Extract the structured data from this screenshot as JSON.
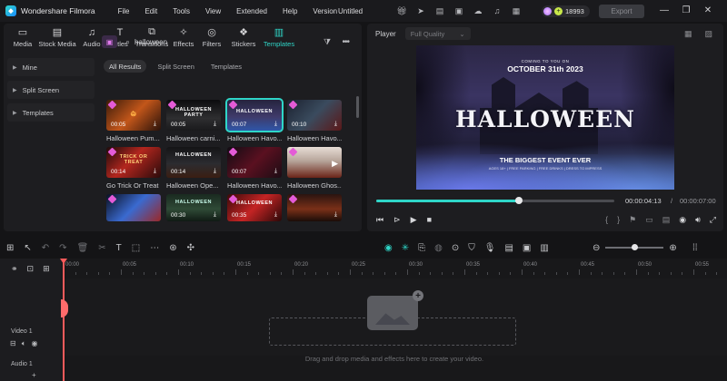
{
  "app": {
    "name": "Wondershare Filmora",
    "doc_title": "Untitled",
    "menu": [
      "File",
      "Edit",
      "Tools",
      "View",
      "Extended",
      "Help",
      "Version"
    ],
    "credits": "18993",
    "export_label": "Export"
  },
  "tabs": [
    {
      "label": "Media",
      "icon": "media-icon"
    },
    {
      "label": "Stock Media",
      "icon": "stock-media-icon"
    },
    {
      "label": "Audio",
      "icon": "audio-icon"
    },
    {
      "label": "Titles",
      "icon": "titles-icon"
    },
    {
      "label": "Transitions",
      "icon": "transitions-icon"
    },
    {
      "label": "Effects",
      "icon": "effects-icon"
    },
    {
      "label": "Filters",
      "icon": "filters-icon"
    },
    {
      "label": "Stickers",
      "icon": "stickers-icon"
    },
    {
      "label": "Templates",
      "icon": "templates-icon",
      "active": true
    }
  ],
  "sidebar": {
    "items": [
      {
        "label": "Mine"
      },
      {
        "label": "Split Screen"
      },
      {
        "label": "Templates"
      }
    ]
  },
  "search": {
    "value": "halloween",
    "placeholder": "Search"
  },
  "filters": [
    {
      "label": "All Results",
      "active": true
    },
    {
      "label": "Split Screen",
      "active": false
    },
    {
      "label": "Templates",
      "active": false
    }
  ],
  "results": [
    {
      "name": "Halloween Pum...",
      "duration": "00:05",
      "premium": true
    },
    {
      "name": "Halloween carni...",
      "duration": "00:05",
      "premium": true
    },
    {
      "name": "Halloween Havo...",
      "duration": "00:07",
      "premium": true,
      "selected": true
    },
    {
      "name": "Halloween Havo...",
      "duration": "00:10",
      "premium": true
    },
    {
      "name": "Go Trick Or Treat",
      "duration": "00:14",
      "premium": true
    },
    {
      "name": "Halloween Ope...",
      "duration": "00:14",
      "premium": false
    },
    {
      "name": "Halloween Havo...",
      "duration": "00:07",
      "premium": true
    },
    {
      "name": "Halloween Ghos...",
      "duration": "",
      "premium": true
    },
    {
      "name": "",
      "duration": "",
      "premium": true
    },
    {
      "name": "",
      "duration": "00:30",
      "premium": false
    },
    {
      "name": "",
      "duration": "00:35",
      "premium": true
    },
    {
      "name": "",
      "duration": "",
      "premium": true
    }
  ],
  "player": {
    "label": "Player",
    "quality": "Full Quality",
    "current_time": "00:00:04:13",
    "total_time": "00:00:07:00",
    "progress": 0.6,
    "video_text": {
      "coming": "COMING TO YOU ON",
      "date": "OCTOBER 31th 2023",
      "title": "HALLOWEEN",
      "event": "THE BIGGEST EVENT EVER",
      "details": "AGES 18+  |  FREE PARKING  |  FREE DRINKS  |  DRESS TO IMPRESS"
    }
  },
  "timeline": {
    "ticks": [
      "00:00",
      "00:05",
      "00:10",
      "00:15",
      "00:20",
      "00:25",
      "00:30",
      "00:35",
      "00:40",
      "00:45",
      "00:50",
      "00:55"
    ],
    "video_track": "Video 1",
    "audio_track": "Audio 1",
    "drop_hint": "Drag and drop media and effects here to create your video.",
    "zoom": 0.5
  }
}
